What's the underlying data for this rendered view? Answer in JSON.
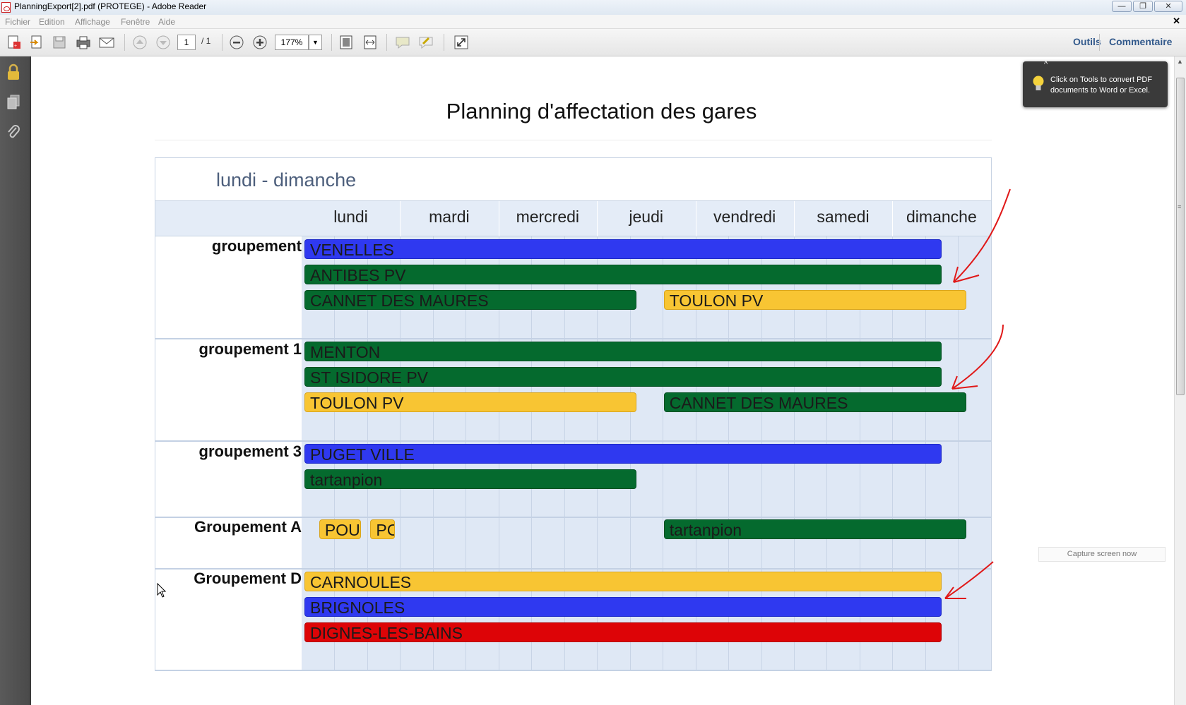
{
  "window": {
    "title": "PlanningExport[2].pdf (PROTEGE) - Adobe Reader"
  },
  "menu": [
    "Fichier",
    "Edition",
    "Affichage",
    "Fenêtre",
    "Aide"
  ],
  "toolbar": {
    "page_current": "1",
    "page_total": "/ 1",
    "zoom": "177%",
    "tools_label": "Outils",
    "comment_label": "Commentaire"
  },
  "tooltip": {
    "text": "Click on Tools to convert PDF documents to Word or Excel."
  },
  "capture_button": "Capture screen now",
  "document": {
    "title": "Planning d'affectation des gares",
    "range": "lundi - dimanche",
    "days": [
      "lundi",
      "mardi",
      "mercredi",
      "jeudi",
      "vendredi",
      "samedi",
      "dimanche"
    ],
    "groups": [
      {
        "name": "groupement",
        "bars": [
          {
            "label": "VENELLES",
            "color": "#2f39f0",
            "start_day": 0,
            "end_day": 6.5
          },
          {
            "label": "ANTIBES PV",
            "color": "#056a2e",
            "start_day": 0,
            "end_day": 6.5
          },
          {
            "label": "CANNET DES MAURES",
            "color": "#056a2e",
            "start_day": 0,
            "end_day": 3.4
          },
          {
            "label": "TOULON PV",
            "color": "#f8c533",
            "start_day": 3.65,
            "end_day": 6.75
          }
        ]
      },
      {
        "name": "groupement 1",
        "bars": [
          {
            "label": "MENTON",
            "color": "#056a2e",
            "start_day": 0,
            "end_day": 6.5
          },
          {
            "label": "ST ISIDORE PV",
            "color": "#056a2e",
            "start_day": 0,
            "end_day": 6.5
          },
          {
            "label": "TOULON PV",
            "color": "#f8c533",
            "start_day": 0,
            "end_day": 3.4
          },
          {
            "label": "CANNET DES MAURES",
            "color": "#056a2e",
            "start_day": 3.65,
            "end_day": 6.75
          }
        ]
      },
      {
        "name": "groupement 3",
        "bars": [
          {
            "label": "PUGET VILLE",
            "color": "#2f39f0",
            "start_day": 0,
            "end_day": 6.5
          },
          {
            "label": "tartanpion",
            "color": "#056a2e",
            "start_day": 0,
            "end_day": 3.4
          }
        ]
      },
      {
        "name": "Groupement A",
        "bars": [
          {
            "label": "POU",
            "color": "#f8c533",
            "start_day": 0.15,
            "end_day": 0.6
          },
          {
            "label": "PC",
            "color": "#f8c533",
            "start_day": 0.67,
            "end_day": 0.95
          },
          {
            "label": "tartanpion",
            "color": "#056a2e",
            "start_day": 3.65,
            "end_day": 6.75
          }
        ]
      },
      {
        "name": "Groupement D",
        "bars": [
          {
            "label": "CARNOULES",
            "color": "#f8c533",
            "start_day": 0,
            "end_day": 6.5
          },
          {
            "label": "BRIGNOLES",
            "color": "#2f39f0",
            "start_day": 0,
            "end_day": 6.5
          },
          {
            "label": "DIGNES-LES-BAINS",
            "color": "#dd0407",
            "start_day": 0,
            "end_day": 6.5
          }
        ]
      }
    ]
  },
  "annotation_color": "#e01818"
}
